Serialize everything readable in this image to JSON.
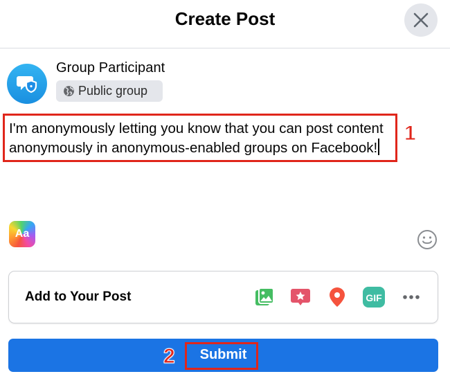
{
  "header": {
    "title": "Create Post"
  },
  "author": {
    "name": "Group Participant",
    "privacy": "Public group"
  },
  "composer": {
    "text": "I'm anonymously letting you know that you can post content anonymously in anonymous-enabled groups on Facebook!"
  },
  "background_button": {
    "label": "Aa"
  },
  "add_to_post": {
    "label": "Add to Your Post",
    "tools": [
      "photo-video-icon",
      "tag-star-icon",
      "location-pin-icon",
      "gif-icon",
      "more-icon"
    ],
    "gif_label": "GIF"
  },
  "submit": {
    "label": "Submit"
  },
  "annotations": {
    "step1": "1",
    "step2": "2"
  },
  "colors": {
    "accent": "#1b74e4",
    "annotation": "#e0261b"
  }
}
